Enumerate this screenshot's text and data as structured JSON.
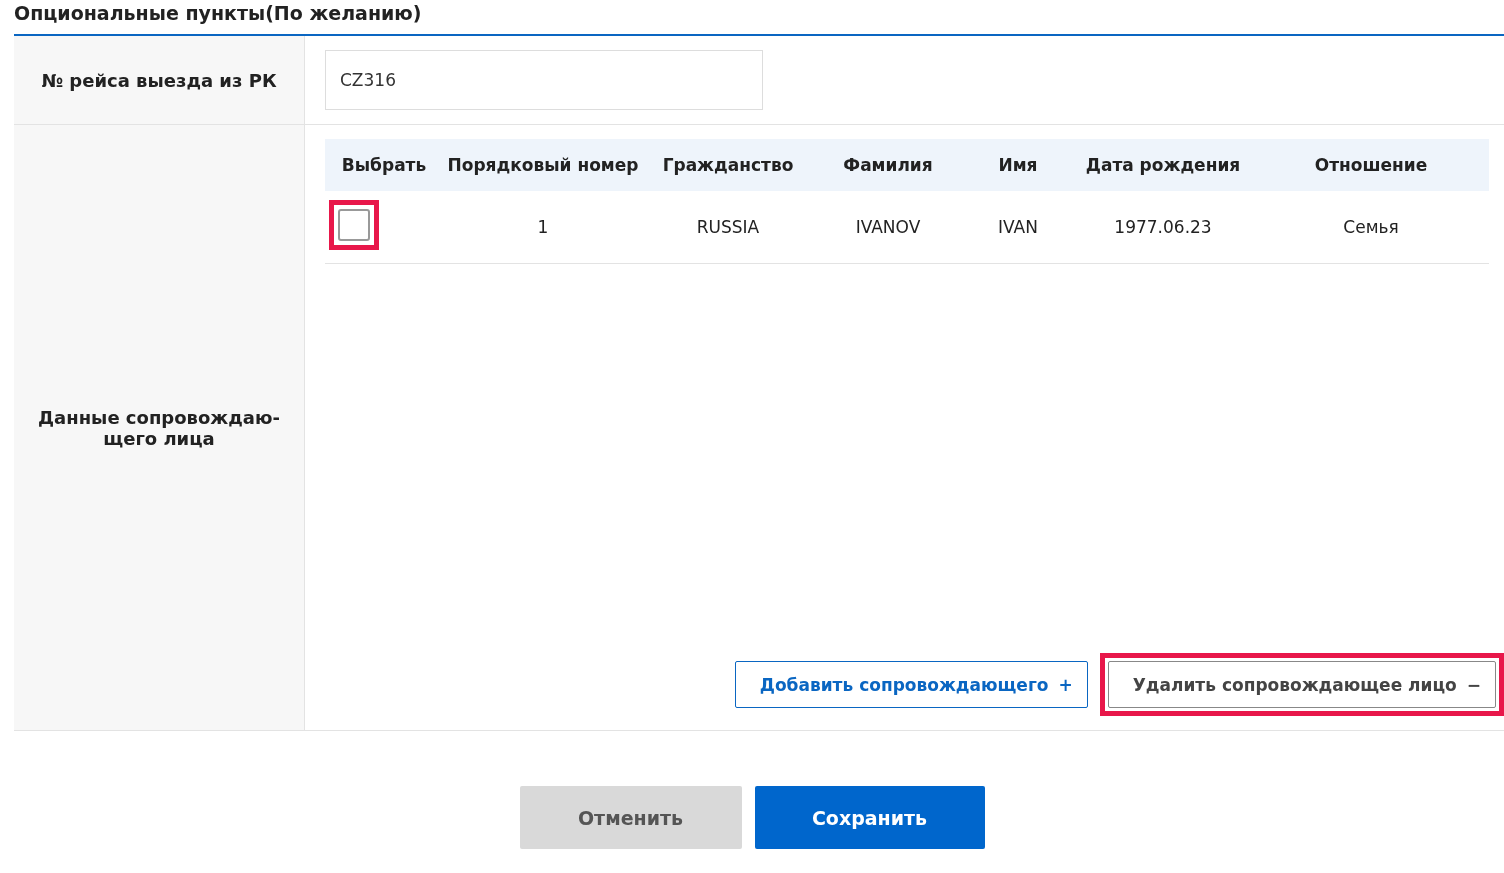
{
  "section_title": "Опциональные пункты(По желанию)",
  "fields": [
    {
      "label": "№ рейса выезда из РК",
      "kind": "input",
      "value": "CZ316"
    },
    {
      "label": "Данные сопровождаю-щего лица",
      "kind": "table"
    }
  ],
  "table": {
    "columns": [
      "Выбрать",
      "Порядковый номер",
      "Гражданство",
      "Фамилия",
      "Имя",
      "Дата рождения",
      "Отношение"
    ],
    "rows": [
      {
        "checked": false,
        "highlighted": true,
        "cells": [
          "",
          "1",
          "RUSSIA",
          "IVANOV",
          "IVAN",
          "1977.06.23",
          "Семья"
        ]
      }
    ]
  },
  "table_buttons": [
    {
      "label": "Добавить сопровождающего",
      "icon": "+",
      "kind": "primary-outline",
      "highlighted": false
    },
    {
      "label": "Удалить сопровождающее лицо",
      "icon": "−",
      "kind": "secondary-outline",
      "highlighted": true
    }
  ],
  "footer_buttons": [
    {
      "label": "Отменить",
      "kind": "cancel"
    },
    {
      "label": "Сохранить",
      "kind": "save"
    }
  ]
}
